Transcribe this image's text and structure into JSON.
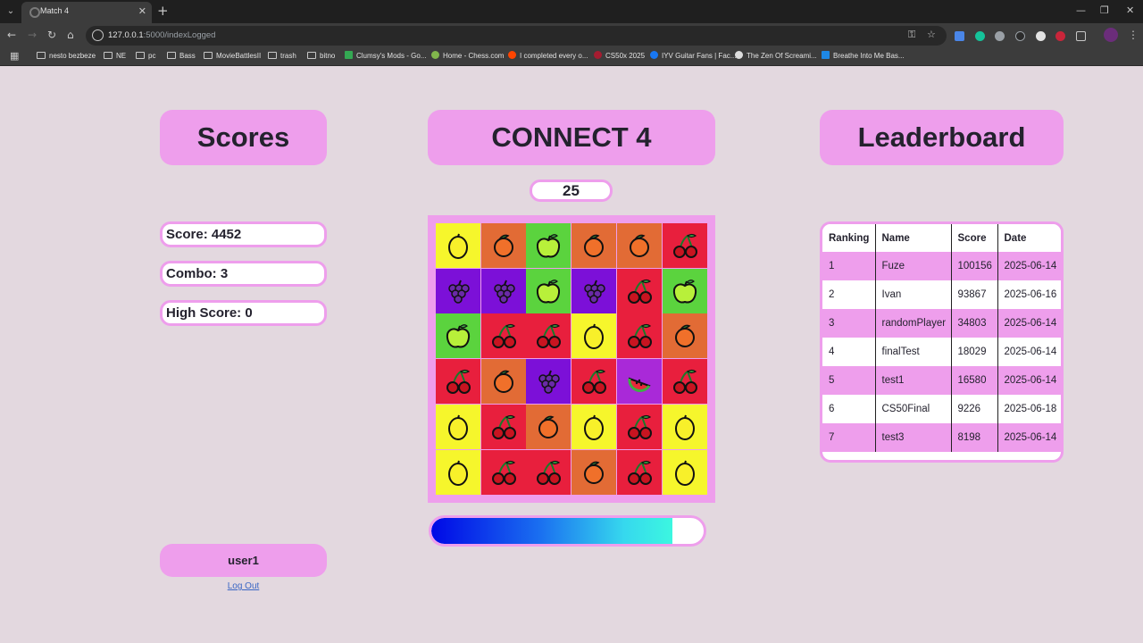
{
  "browser": {
    "tab_title": "Match 4",
    "url_host": "127.0.0.1",
    "url_path": ":5000/indexLogged",
    "bookmarks": [
      {
        "label": "nesto bezbeze",
        "icon": "folder-icon"
      },
      {
        "label": "NE",
        "icon": "folder-icon"
      },
      {
        "label": "pc",
        "icon": "folder-icon"
      },
      {
        "label": "Bass",
        "icon": "folder-icon"
      },
      {
        "label": "MovieBattlesII",
        "icon": "folder-icon"
      },
      {
        "label": "trash",
        "icon": "folder-icon"
      },
      {
        "label": "bitno",
        "icon": "folder-icon"
      },
      {
        "label": "Clumsy's Mods - Go...",
        "icon": "site-icon",
        "color": "#34a853"
      },
      {
        "label": "Home - Chess.com",
        "icon": "pawn-icon",
        "color": "#81b64c"
      },
      {
        "label": "I completed every o...",
        "icon": "site-icon",
        "color": "#ff4500"
      },
      {
        "label": "CS50x 2025",
        "icon": "site-icon",
        "color": "#a51c30"
      },
      {
        "label": "IYV Guitar Fans | Fac...",
        "icon": "facebook-icon",
        "color": "#1877f2"
      },
      {
        "label": "The Zen Of Screami...",
        "icon": "google-icon",
        "color": "#dddddd"
      },
      {
        "label": "Breathe Into Me Bas...",
        "icon": "site-icon",
        "color": "#1e88e5"
      }
    ]
  },
  "page": {
    "scores_title": "Scores",
    "game_title": "CONNECT 4",
    "leaderboard_title": "Leaderboard",
    "timer": "25",
    "score_label": "Score: 4452",
    "combo_label": "Combo: 3",
    "high_score_label": "High Score: 0",
    "username": "user1",
    "logout_label": "Log Out",
    "progress_fraction": 0.885
  },
  "colors": {
    "accent_pink": "#ee9eec",
    "background": "#e3d8df",
    "lemon": "#f6f62c",
    "orange": "#e26b35",
    "apple": "#5bd33e",
    "grape": "#7c10d8",
    "cherry": "#e81f3d",
    "watermelon": "#a929d8"
  },
  "board": {
    "rows": [
      [
        "lemon",
        "orange",
        "apple",
        "orange",
        "orange",
        "cherry"
      ],
      [
        "grape",
        "grape",
        "apple",
        "grape",
        "cherry",
        "apple"
      ],
      [
        "apple",
        "cherry",
        "cherry",
        "lemon",
        "cherry",
        "orange"
      ],
      [
        "cherry",
        "orange",
        "grape",
        "cherry",
        "watermelon",
        "cherry"
      ],
      [
        "lemon",
        "cherry",
        "orange",
        "lemon",
        "cherry",
        "lemon"
      ],
      [
        "lemon",
        "cherry",
        "cherry",
        "orange",
        "cherry",
        "lemon"
      ]
    ]
  },
  "leaderboard": {
    "headers": [
      "Ranking",
      "Name",
      "Score",
      "Date"
    ],
    "rows": [
      [
        "1",
        "Fuze",
        "100156",
        "2025-06-14"
      ],
      [
        "2",
        "Ivan",
        "93867",
        "2025-06-16"
      ],
      [
        "3",
        "randomPlayer",
        "34803",
        "2025-06-14"
      ],
      [
        "4",
        "finalTest",
        "18029",
        "2025-06-14"
      ],
      [
        "5",
        "test1",
        "16580",
        "2025-06-14"
      ],
      [
        "6",
        "CS50Final",
        "9226",
        "2025-06-18"
      ],
      [
        "7",
        "test3",
        "8198",
        "2025-06-14"
      ]
    ]
  }
}
